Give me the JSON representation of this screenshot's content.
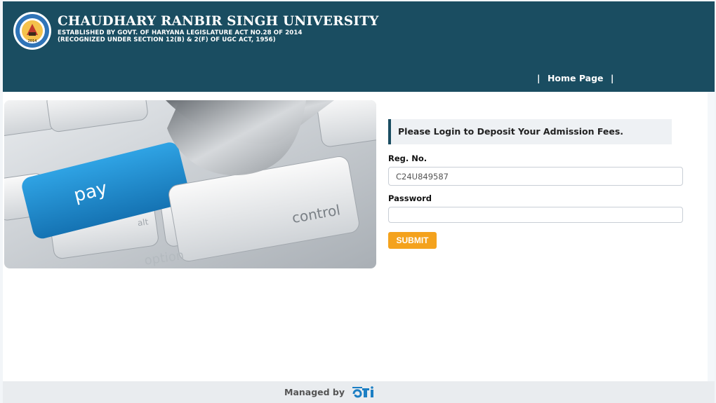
{
  "header": {
    "title": "CHAUDHARY RANBIR SINGH UNIVERSITY",
    "subtitle_line1": "ESTABLISHED BY GOVT. OF HARYANA LEGISLATURE ACT NO.28 OF 2014",
    "subtitle_line2": "(RECOGNIZED UNDER SECTION 12(B) & 2(F) OF UGC ACT, 1956)",
    "logo_year": "2014",
    "nav_separator": "|",
    "nav_home": "Home Page"
  },
  "hero": {
    "key_pay": "pay",
    "key_control": "control",
    "key_alt": "alt",
    "key_option": "option"
  },
  "login": {
    "notice": "Please Login to Deposit Your Admission Fees.",
    "reg_label": "Reg. No.",
    "reg_value": "C24U849587",
    "password_label": "Password",
    "password_value": "",
    "submit_label": "SUBMIT"
  },
  "footer": {
    "managed_by": "Managed by"
  },
  "colors": {
    "header_bg": "#1a4d61",
    "submit_bg": "#f4a21d",
    "footer_bg": "#e9ecef",
    "pay_key": "#1f8fd0"
  }
}
